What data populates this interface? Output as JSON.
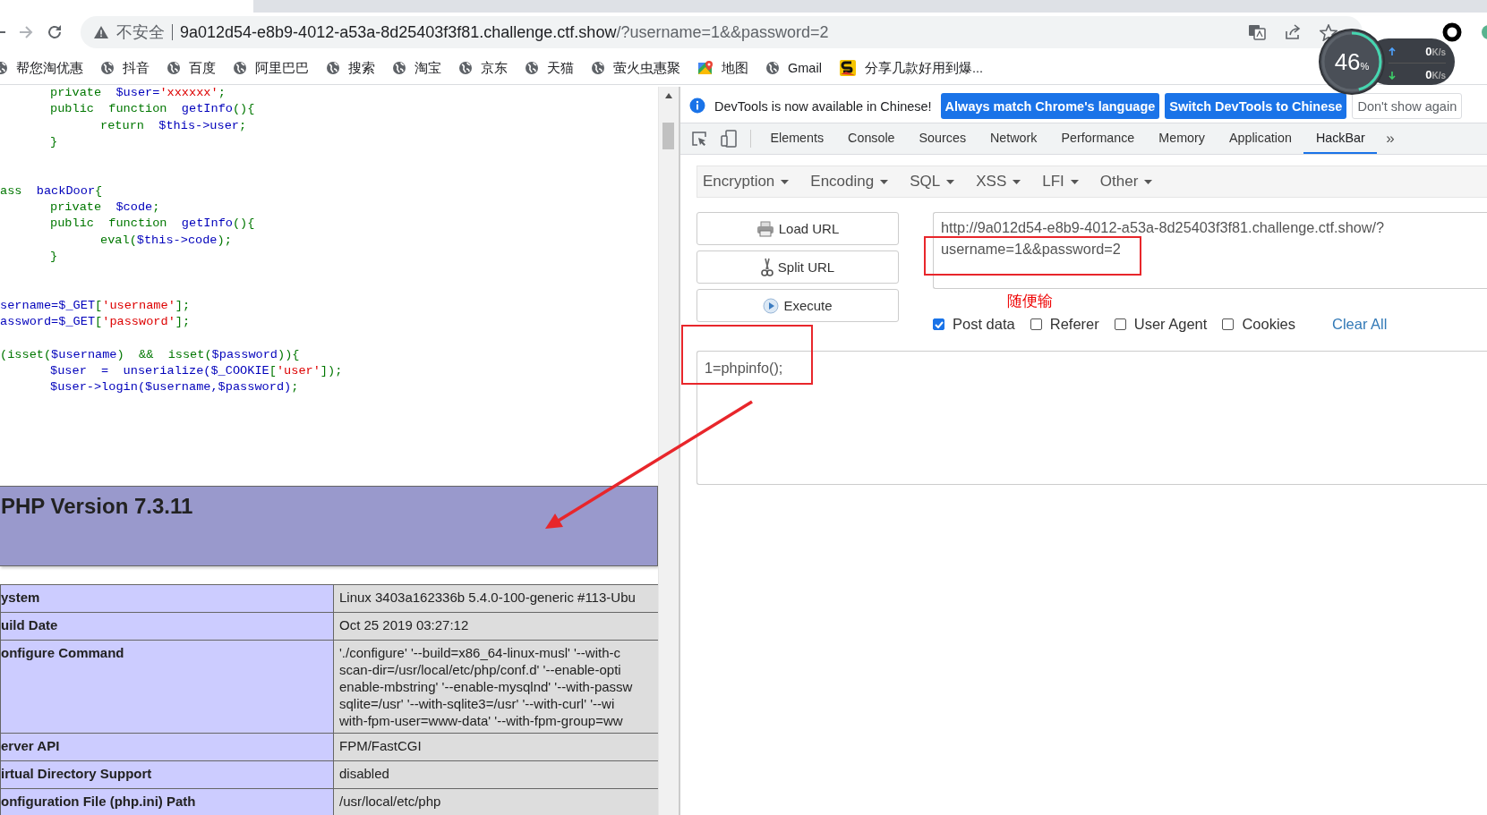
{
  "browser": {
    "address_bar": {
      "security_label": "不安全",
      "host": "9a012d54-e8b9-4012-a53a-8d25403f3f81.challenge.ctf.show",
      "path": "/?username=1&&password=2"
    },
    "bookmarks": [
      {
        "label": "帮您淘优惠",
        "kind": "globe"
      },
      {
        "label": "抖音",
        "kind": "globe"
      },
      {
        "label": "百度",
        "kind": "globe"
      },
      {
        "label": "阿里巴巴",
        "kind": "globe"
      },
      {
        "label": "搜索",
        "kind": "globe"
      },
      {
        "label": "淘宝",
        "kind": "globe"
      },
      {
        "label": "京东",
        "kind": "globe"
      },
      {
        "label": "天猫",
        "kind": "globe"
      },
      {
        "label": "萤火虫惠聚",
        "kind": "globe"
      },
      {
        "label": "地图",
        "kind": "map"
      },
      {
        "label": "Gmail",
        "kind": "globe"
      },
      {
        "label": "分享几款好用到爆...",
        "kind": "app"
      }
    ],
    "speed_widget": {
      "percent": "46",
      "percent_sign": "%",
      "level": 0.46,
      "upload": "0",
      "upload_unit": "K/s",
      "download": "0",
      "download_unit": "K/s"
    }
  },
  "page": {
    "code_lines": [
      {
        "kind": "code",
        "segments": [
          {
            "kind": "plain",
            "text": "\tprivate  "
          },
          {
            "kind": "name",
            "text": "$user="
          },
          {
            "kind": "string",
            "text": "'xxxxxx'"
          },
          {
            "kind": "plain",
            "text": ";"
          }
        ]
      },
      {
        "kind": "code",
        "segments": [
          {
            "kind": "plain",
            "text": "\tpublic  function  "
          },
          {
            "kind": "name",
            "text": "getInfo"
          },
          {
            "kind": "plain",
            "text": "(){"
          }
        ]
      },
      {
        "kind": "code",
        "segments": [
          {
            "kind": "plain",
            "text": "\t\treturn  "
          },
          {
            "kind": "name",
            "text": "$this->user"
          },
          {
            "kind": "plain",
            "text": ";"
          }
        ]
      },
      {
        "kind": "code",
        "segments": [
          {
            "kind": "plain",
            "text": "\t}"
          }
        ]
      },
      {
        "kind": "blank"
      },
      {
        "kind": "blank"
      },
      {
        "kind": "code",
        "segments": [
          {
            "kind": "plain",
            "text": "ass  "
          },
          {
            "kind": "name",
            "text": "backDoor"
          },
          {
            "kind": "plain",
            "text": "{"
          }
        ]
      },
      {
        "kind": "code",
        "segments": [
          {
            "kind": "plain",
            "text": "\tprivate  "
          },
          {
            "kind": "name",
            "text": "$code"
          },
          {
            "kind": "plain",
            "text": ";"
          }
        ]
      },
      {
        "kind": "code",
        "segments": [
          {
            "kind": "plain",
            "text": "\tpublic  function  "
          },
          {
            "kind": "name",
            "text": "getInfo"
          },
          {
            "kind": "plain",
            "text": "(){"
          }
        ]
      },
      {
        "kind": "code",
        "segments": [
          {
            "kind": "plain",
            "text": "\t\teval("
          },
          {
            "kind": "name",
            "text": "$this->code"
          },
          {
            "kind": "plain",
            "text": ");"
          }
        ]
      },
      {
        "kind": "code",
        "segments": [
          {
            "kind": "plain",
            "text": "\t}"
          }
        ]
      },
      {
        "kind": "blank"
      },
      {
        "kind": "blank"
      },
      {
        "kind": "code",
        "segments": [
          {
            "kind": "name",
            "text": "sername=$_GET"
          },
          {
            "kind": "plain",
            "text": "["
          },
          {
            "kind": "string",
            "text": "'username'"
          },
          {
            "kind": "plain",
            "text": "];"
          }
        ]
      },
      {
        "kind": "code",
        "segments": [
          {
            "kind": "name",
            "text": "assword=$_GET"
          },
          {
            "kind": "plain",
            "text": "["
          },
          {
            "kind": "string",
            "text": "'password'"
          },
          {
            "kind": "plain",
            "text": "];"
          }
        ]
      },
      {
        "kind": "blank"
      },
      {
        "kind": "code",
        "segments": [
          {
            "kind": "plain",
            "text": "(isset("
          },
          {
            "kind": "name",
            "text": "$username"
          },
          {
            "kind": "plain",
            "text": ")  &&  isset("
          },
          {
            "kind": "name",
            "text": "$password"
          },
          {
            "kind": "plain",
            "text": ")){"
          }
        ]
      },
      {
        "kind": "code",
        "segments": [
          {
            "kind": "name",
            "text": "\t$user  =  unserialize($_COOKIE"
          },
          {
            "kind": "plain",
            "text": "["
          },
          {
            "kind": "string",
            "text": "'user'"
          },
          {
            "kind": "plain",
            "text": "]);"
          }
        ]
      },
      {
        "kind": "code",
        "segments": [
          {
            "kind": "name",
            "text": "\t$user->login($username,$password)"
          },
          {
            "kind": "plain",
            "text": ";"
          }
        ]
      }
    ],
    "phpinfo": {
      "title": "PHP Version 7.3.11",
      "rows": [
        {
          "label": "ystem",
          "value_lines": [
            "Linux 3403a162336b 5.4.0-100-generic #113-Ubu"
          ]
        },
        {
          "label": "uild Date",
          "value_lines": [
            "Oct 25 2019 03:27:12"
          ]
        },
        {
          "label": "onfigure Command",
          "value_lines": [
            "'./configure' '--build=x86_64-linux-musl' '--with-c",
            "scan-dir=/usr/local/etc/php/conf.d' '--enable-opti",
            "enable-mbstring' '--enable-mysqlnd' '--with-passw",
            "sqlite=/usr' '--with-sqlite3=/usr' '--with-curl' '--wi",
            "with-fpm-user=www-data' '--with-fpm-group=ww"
          ]
        },
        {
          "label": "erver API",
          "value_lines": [
            "FPM/FastCGI"
          ]
        },
        {
          "label": "irtual Directory Support",
          "value_lines": [
            "disabled"
          ]
        },
        {
          "label": "onfiguration File (php.ini) Path",
          "value_lines": [
            "/usr/local/etc/php"
          ]
        }
      ]
    }
  },
  "devtools": {
    "infobar": {
      "message": "DevTools is now available in Chinese!",
      "buttons": [
        {
          "label": "Always match Chrome's language",
          "kind": "primary"
        },
        {
          "label": "Switch DevTools to Chinese",
          "kind": "primary"
        },
        {
          "label": "Don't show again",
          "kind": "secondary"
        }
      ]
    },
    "tabs": [
      {
        "label": "Elements",
        "selected": false
      },
      {
        "label": "Console",
        "selected": false
      },
      {
        "label": "Sources",
        "selected": false
      },
      {
        "label": "Network",
        "selected": false
      },
      {
        "label": "Performance",
        "selected": false
      },
      {
        "label": "Memory",
        "selected": false
      },
      {
        "label": "Application",
        "selected": false
      },
      {
        "label": "HackBar",
        "selected": true
      }
    ],
    "more_tabs": "»",
    "hackbar": {
      "menus": [
        "Encryption",
        "Encoding",
        "SQL",
        "XSS",
        "LFI",
        "Other"
      ],
      "actions": [
        {
          "label": "Load URL",
          "kind": "load"
        },
        {
          "label": "Split URL",
          "kind": "split"
        },
        {
          "label": "Execute",
          "kind": "execute"
        }
      ],
      "url_lines": [
        "http://9a012d54-e8b9-4012-a53a-8d25403f3f81.challenge.ctf.show/?",
        "username=1&&password=2"
      ],
      "note": "随便输",
      "options": [
        {
          "label": "Post data",
          "checked": true
        },
        {
          "label": "Referer",
          "checked": false
        },
        {
          "label": "User Agent",
          "checked": false
        },
        {
          "label": "Cookies",
          "checked": false
        }
      ],
      "clear_all": "Clear All",
      "post_body": "1=phpinfo();"
    }
  }
}
